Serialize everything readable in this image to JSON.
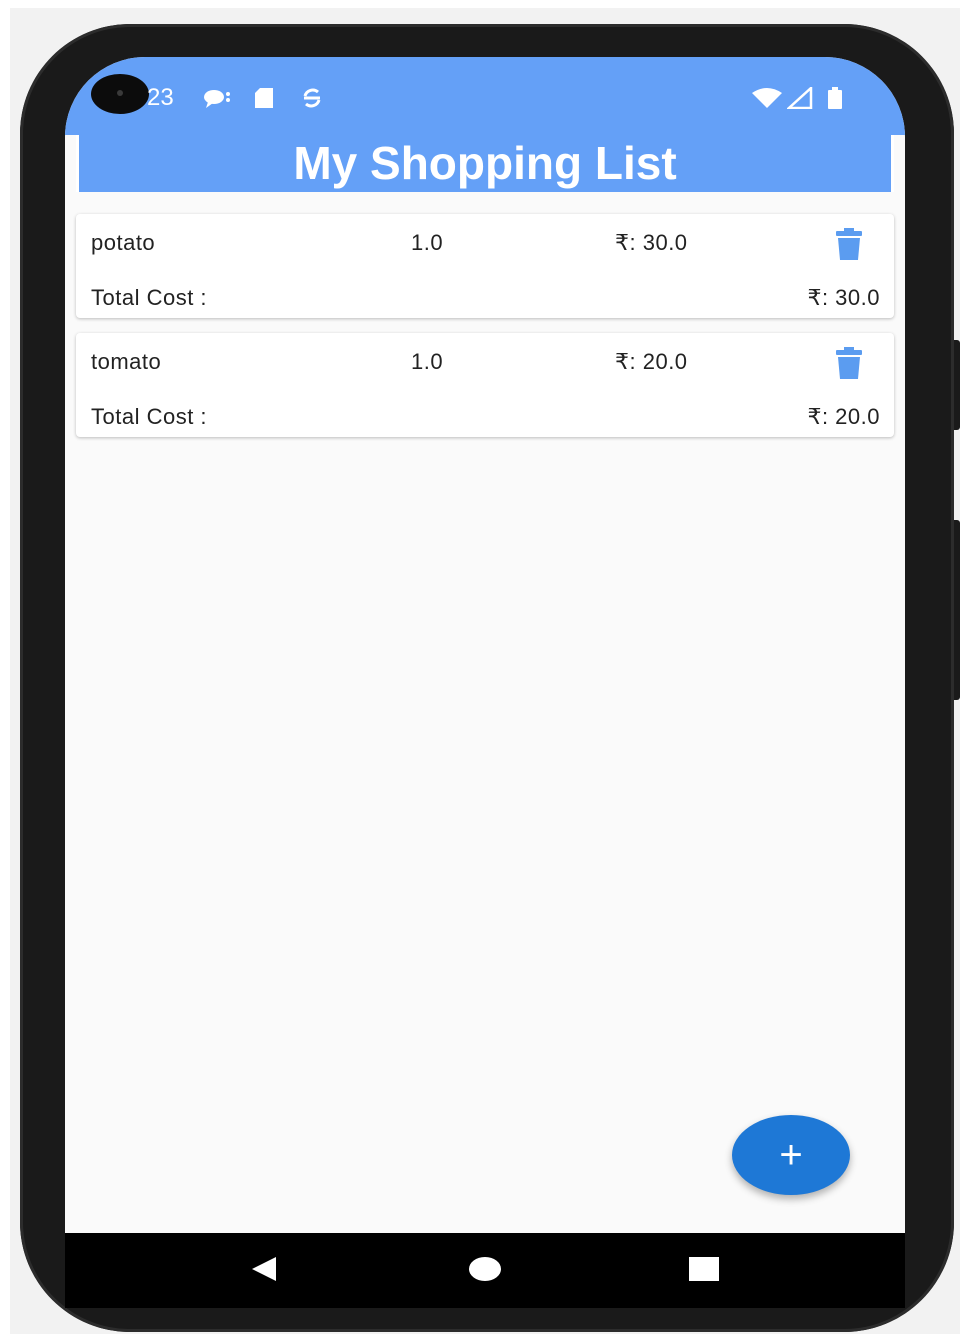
{
  "status_bar": {
    "time": "23",
    "icons_left": [
      "chat-bubble-icon",
      "sd-card-icon",
      "sync-icon"
    ],
    "icons_right": [
      "wifi-icon",
      "cell-signal-icon",
      "battery-icon"
    ]
  },
  "app_bar": {
    "title": "My Shopping List"
  },
  "items": [
    {
      "name": "potato",
      "quantity": "1.0",
      "price": "₹: 30.0",
      "total_label": "Total Cost :",
      "total_value": "₹: 30.0"
    },
    {
      "name": "tomato",
      "quantity": "1.0",
      "price": "₹: 20.0",
      "total_label": "Total Cost :",
      "total_value": "₹: 20.0"
    }
  ],
  "fab": {
    "label": "+"
  },
  "colors": {
    "primary": "#64a0f7",
    "fab": "#1e78d6",
    "delete_icon": "#5b9cf0"
  },
  "nav_bar": {
    "buttons": [
      "back-icon",
      "home-icon",
      "recents-icon"
    ]
  }
}
